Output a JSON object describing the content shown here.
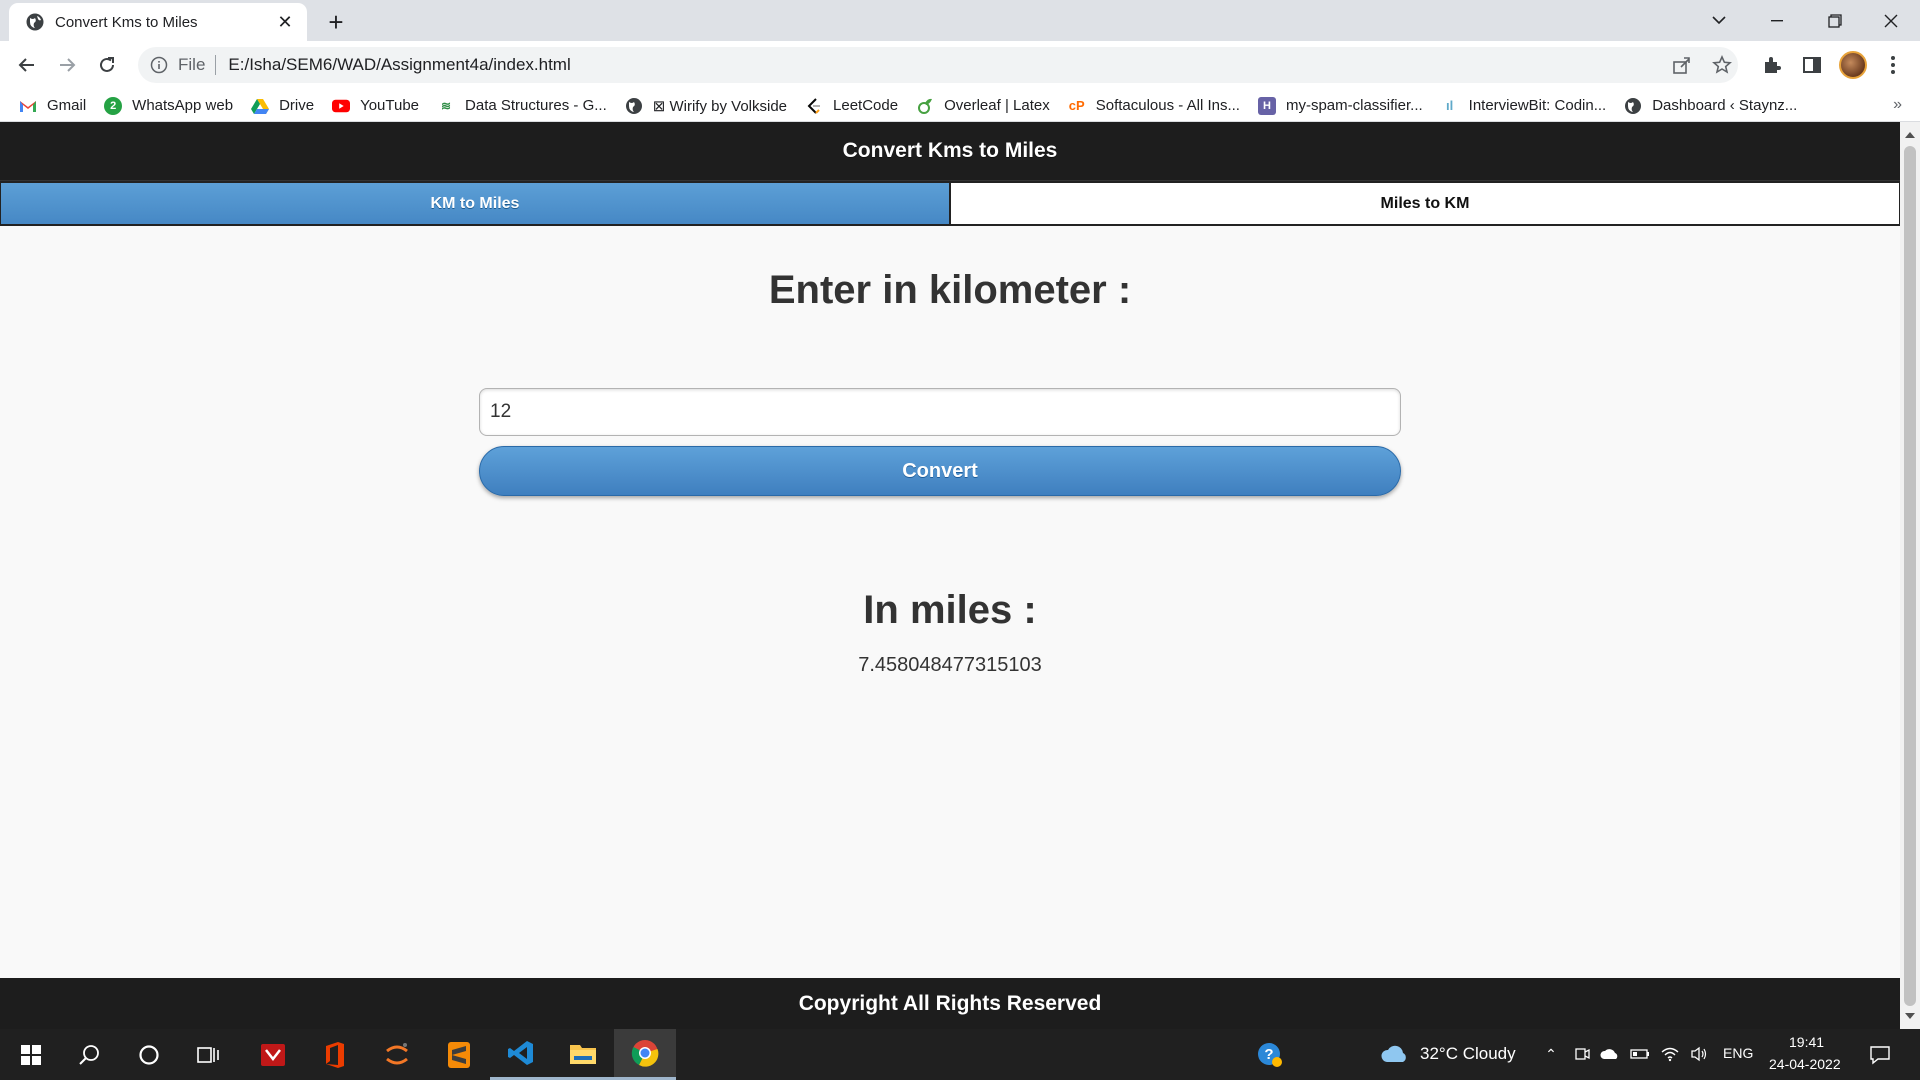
{
  "browser": {
    "tab_title": "Convert Kms to Miles",
    "address_scheme": "File",
    "address_url": "E:/Isha/SEM6/WAD/Assignment4a/index.html",
    "bookmarks": [
      {
        "label": "Gmail",
        "icon": "gmail-icon"
      },
      {
        "label": "WhatsApp web",
        "icon": "whatsapp-icon"
      },
      {
        "label": "Drive",
        "icon": "drive-icon"
      },
      {
        "label": "YouTube",
        "icon": "youtube-icon"
      },
      {
        "label": "Data Structures - G...",
        "icon": "gfg-icon"
      },
      {
        "label": "⊠ Wirify by Volkside",
        "icon": "globe-icon"
      },
      {
        "label": "LeetCode",
        "icon": "leetcode-icon"
      },
      {
        "label": "Overleaf | Latex",
        "icon": "overleaf-icon"
      },
      {
        "label": "Softaculous - All Ins...",
        "icon": "softaculous-icon"
      },
      {
        "label": "my-spam-classifier...",
        "icon": "heroku-icon"
      },
      {
        "label": "InterviewBit: Codin...",
        "icon": "interviewbit-icon"
      },
      {
        "label": "Dashboard ‹ Staynz...",
        "icon": "globe-icon"
      }
    ]
  },
  "page": {
    "header_title": "Convert Kms to Miles",
    "nav_tabs": [
      {
        "label": "KM to Miles",
        "active": true
      },
      {
        "label": "Miles to KM",
        "active": false
      }
    ],
    "input_heading": "Enter in kilometer :",
    "input_value": "12",
    "convert_label": "Convert",
    "result_heading": "In miles :",
    "result_value": "7.458048477315103",
    "footer_text": "Copyright All Rights Reserved",
    "colors": {
      "accent": "#4a8ccb",
      "header": "#1d1d1d"
    }
  },
  "taskbar": {
    "weather": "32°C  Cloudy",
    "language": "ENG",
    "time": "19:41",
    "date": "24-04-2022"
  }
}
